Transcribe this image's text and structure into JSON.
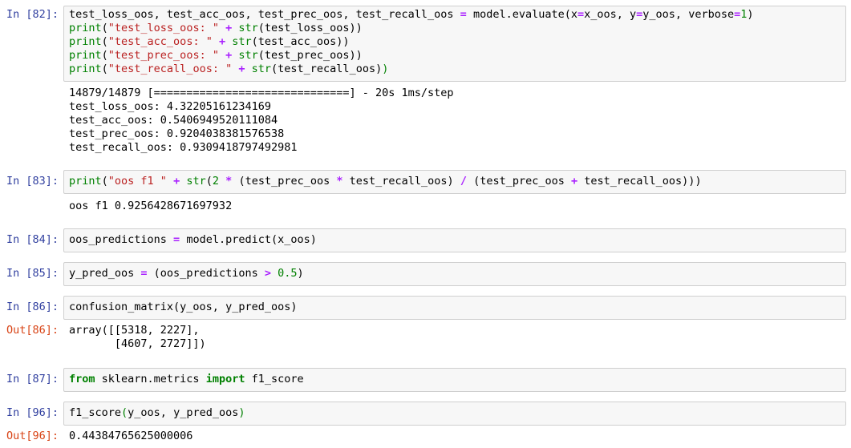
{
  "cells": [
    {
      "prompt": "In [82]:",
      "input_lines": [
        [
          [
            "t",
            "test_loss_oos, test_acc_oos, test_prec_oos, test_recall_oos "
          ],
          [
            "op",
            "="
          ],
          [
            "t",
            " model.evaluate(x"
          ],
          [
            "op",
            "="
          ],
          [
            "t",
            "x_oos, y"
          ],
          [
            "op",
            "="
          ],
          [
            "t",
            "y_oos, verbose"
          ],
          [
            "op",
            "="
          ],
          [
            "num",
            "1"
          ],
          [
            "t",
            ")"
          ]
        ],
        [
          [
            "bi",
            "print"
          ],
          [
            "t",
            "("
          ],
          [
            "str",
            "\"test_loss_oos: \""
          ],
          [
            "t",
            " "
          ],
          [
            "op",
            "+"
          ],
          [
            "t",
            " "
          ],
          [
            "bi",
            "str"
          ],
          [
            "t",
            "(test_loss_oos))"
          ]
        ],
        [
          [
            "bi",
            "print"
          ],
          [
            "t",
            "("
          ],
          [
            "str",
            "\"test_acc_oos: \""
          ],
          [
            "t",
            " "
          ],
          [
            "op",
            "+"
          ],
          [
            "t",
            " "
          ],
          [
            "bi",
            "str"
          ],
          [
            "t",
            "(test_acc_oos))"
          ]
        ],
        [
          [
            "bi",
            "print"
          ],
          [
            "t",
            "("
          ],
          [
            "str",
            "\"test_prec_oos: \""
          ],
          [
            "t",
            " "
          ],
          [
            "op",
            "+"
          ],
          [
            "t",
            " "
          ],
          [
            "bi",
            "str"
          ],
          [
            "t",
            "(test_prec_oos))"
          ]
        ],
        [
          [
            "bi",
            "print"
          ],
          [
            "t",
            "("
          ],
          [
            "str",
            "\"test_recall_oos: \""
          ],
          [
            "t",
            " "
          ],
          [
            "op",
            "+"
          ],
          [
            "t",
            " "
          ],
          [
            "bi",
            "str"
          ],
          [
            "t",
            "(test_recall_oos)"
          ],
          [
            "num",
            ")"
          ]
        ]
      ],
      "output_prompt": "",
      "output_lines": [
        "14879/14879 [==============================] - 20s 1ms/step",
        "test_loss_oos: 4.32205161234169",
        "test_acc_oos: 0.5406949520111084",
        "test_prec_oos: 0.9204038381576538",
        "test_recall_oos: 0.9309418797492981"
      ]
    },
    {
      "prompt": "In [83]:",
      "input_lines": [
        [
          [
            "bi",
            "print"
          ],
          [
            "t",
            "("
          ],
          [
            "str",
            "\"oos f1 \""
          ],
          [
            "t",
            " "
          ],
          [
            "op",
            "+"
          ],
          [
            "t",
            " "
          ],
          [
            "bi",
            "str"
          ],
          [
            "t",
            "("
          ],
          [
            "num",
            "2"
          ],
          [
            "t",
            " "
          ],
          [
            "op",
            "*"
          ],
          [
            "t",
            " (test_prec_oos "
          ],
          [
            "op",
            "*"
          ],
          [
            "t",
            " test_recall_oos) "
          ],
          [
            "op",
            "/"
          ],
          [
            "t",
            " (test_prec_oos "
          ],
          [
            "op",
            "+"
          ],
          [
            "t",
            " test_recall_oos)))"
          ]
        ]
      ],
      "output_prompt": "",
      "output_lines": [
        "oos f1 0.9256428671697932"
      ]
    },
    {
      "prompt": "In [84]:",
      "input_lines": [
        [
          [
            "t",
            "oos_predictions "
          ],
          [
            "op",
            "="
          ],
          [
            "t",
            " model.predict(x_oos)"
          ]
        ]
      ],
      "output_prompt": "",
      "output_lines": []
    },
    {
      "prompt": "In [85]:",
      "input_lines": [
        [
          [
            "t",
            "y_pred_oos "
          ],
          [
            "op",
            "="
          ],
          [
            "t",
            " (oos_predictions "
          ],
          [
            "op",
            ">"
          ],
          [
            "t",
            " "
          ],
          [
            "num",
            "0.5"
          ],
          [
            "t",
            ")"
          ]
        ]
      ],
      "output_prompt": "",
      "output_lines": []
    },
    {
      "prompt": "In [86]:",
      "input_lines": [
        [
          [
            "t",
            "confusion_matrix(y_oos, y_pred_oos)"
          ]
        ]
      ],
      "output_prompt": "Out[86]:",
      "output_lines": [
        "array([[5318, 2227],",
        "       [4607, 2727]])"
      ]
    },
    {
      "prompt": "In [87]:",
      "input_lines": [
        [
          [
            "kw",
            "from"
          ],
          [
            "t",
            " sklearn.metrics "
          ],
          [
            "kw",
            "import"
          ],
          [
            "t",
            " f1_score"
          ]
        ]
      ],
      "output_prompt": "",
      "output_lines": []
    },
    {
      "prompt": "In [96]:",
      "input_lines": [
        [
          [
            "t",
            "f1_score"
          ],
          [
            "num",
            "("
          ],
          [
            "t",
            "y_oos, y_pred_oos"
          ],
          [
            "num",
            ")"
          ]
        ]
      ],
      "output_prompt": "Out[96]:",
      "output_lines": [
        "0.44384765625000006"
      ]
    }
  ]
}
